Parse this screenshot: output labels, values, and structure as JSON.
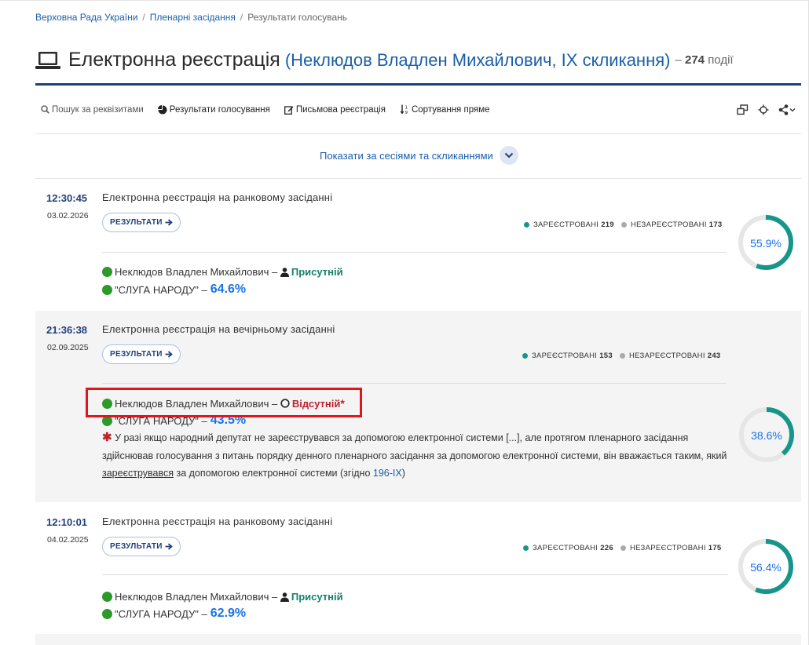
{
  "breadcrumb": [
    "Верховна Рада України",
    "Пленарні засідання",
    "Результати голосувань"
  ],
  "header": {
    "title": "Електронна реєстрація",
    "subject": "(Неклюдов Владлен Михайлович, IX скликання)",
    "count_prefix": "–",
    "count": "274",
    "count_suffix": "події"
  },
  "toolbar": {
    "search": "Пошук за реквізитами",
    "vote_results": "Результати голосування",
    "written_registration": "Письмова реєстрація",
    "sort": "Сортування пряме"
  },
  "sessions_toggle": "Показати за сесіями та скликаннями",
  "labels": {
    "results_button": "РЕЗУЛЬТАТИ",
    "registered": "ЗАРЕЄСТРОВАНІ",
    "unregistered": "НЕЗАРЕЄСТРОВАНІ",
    "dash": "–"
  },
  "events": [
    {
      "time": "12:30:45",
      "date": "03.02.2026",
      "title": "Електронна реєстрація на ранковому засіданні",
      "registered": "219",
      "unregistered": "173",
      "deputy": "Неклюдов Владлен Михайлович",
      "status": "Присутній",
      "party": "\"СЛУГА НАРОДУ\"",
      "party_pct": "64.6%",
      "pct_label": "55.9%",
      "pct_value": 55.9
    },
    {
      "time": "21:36:38",
      "date": "02.09.2025",
      "title": "Електронна реєстрація на вечірньому засіданні",
      "registered": "153",
      "unregistered": "243",
      "deputy": "Неклюдов Владлен Михайлович",
      "status": "Відсутній",
      "party": "\"СЛУГА НАРОДУ\"",
      "party_pct": "43.5%",
      "pct_label": "38.6%",
      "pct_value": 38.6,
      "note_part1": "У разі якщо народний депутат не зареєструвався за допомогою електронної системи [...], але протягом пленарного засідання здійснював голосування з питань порядку денного пленарного засідання за допомогою електронної системи, він вважається таким, який",
      "note_underlined": "зареєструвався",
      "note_part2": "за допомогою електронної системи (згідно",
      "note_link": "196-IX",
      "note_end": ")"
    },
    {
      "time": "12:10:01",
      "date": "04.02.2025",
      "title": "Електронна реєстрація на ранковому засіданні",
      "registered": "226",
      "unregistered": "175",
      "deputy": "Неклюдов Владлен Михайлович",
      "status": "Присутній",
      "party": "\"СЛУГА НАРОДУ\"",
      "party_pct": "62.9%",
      "pct_label": "56.4%",
      "pct_value": 56.4
    }
  ],
  "colors": {
    "ring_fill": "#16968a",
    "ring_track": "#e6e6e6",
    "registered_dot": "#16968a",
    "unregistered_dot": "#aaaaaa",
    "highlight_box": "#e3151c"
  }
}
